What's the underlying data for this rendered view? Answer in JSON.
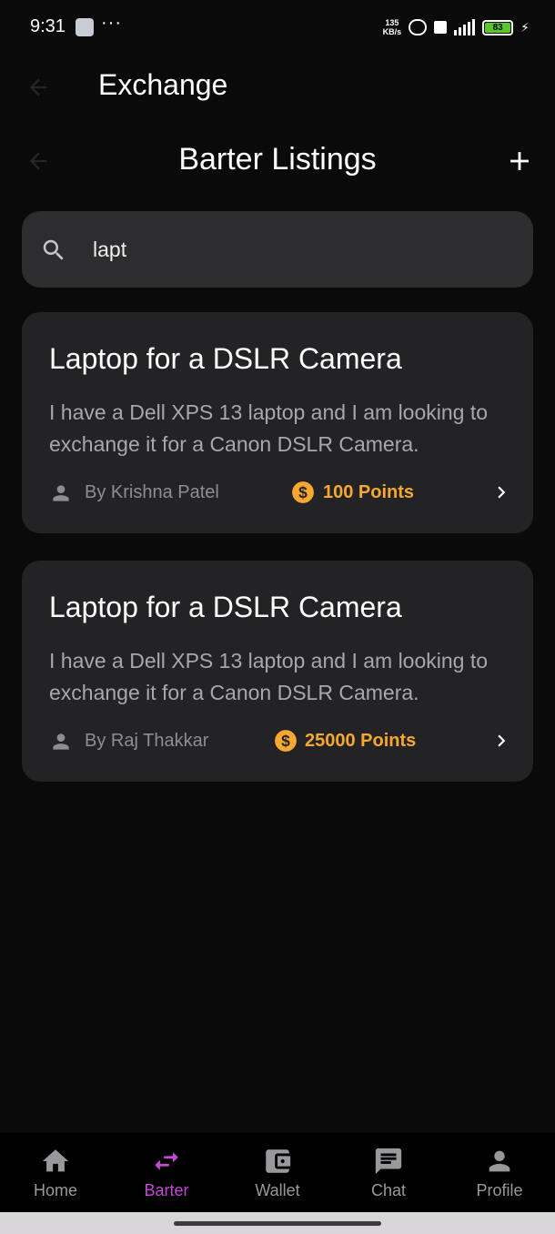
{
  "status_bar": {
    "time": "9:31",
    "more_indicator": "···",
    "net_speed_value": "135",
    "net_speed_unit": "KB/s",
    "battery_level": "83"
  },
  "header": {
    "title": "Exchange"
  },
  "sub_header": {
    "title": "Barter Listings"
  },
  "search": {
    "value": "lapt"
  },
  "listings": [
    {
      "title": "Laptop for a DSLR Camera",
      "description": "I have a Dell XPS 13 laptop and I am looking to exchange it for a Canon DSLR Camera.",
      "author": "By Krishna Patel",
      "points": "100 Points"
    },
    {
      "title": "Laptop for a DSLR Camera",
      "description": "I have a Dell XPS 13 laptop and I am looking to exchange it for a Canon DSLR Camera.",
      "author": "By Raj Thakkar",
      "points": "25000 Points"
    }
  ],
  "bottom_nav": {
    "items": [
      {
        "label": "Home",
        "icon": "home-icon"
      },
      {
        "label": "Barter",
        "icon": "swap-icon"
      },
      {
        "label": "Wallet",
        "icon": "wallet-icon"
      },
      {
        "label": "Chat",
        "icon": "chat-icon"
      },
      {
        "label": "Profile",
        "icon": "person-icon"
      }
    ],
    "active": "Barter"
  },
  "colors": {
    "background": "#0b0a0b",
    "card": "#232224",
    "search_bg": "#2d2c2e",
    "accent_points": "#f6a832",
    "accent_active_nav": "#c44ad6"
  }
}
